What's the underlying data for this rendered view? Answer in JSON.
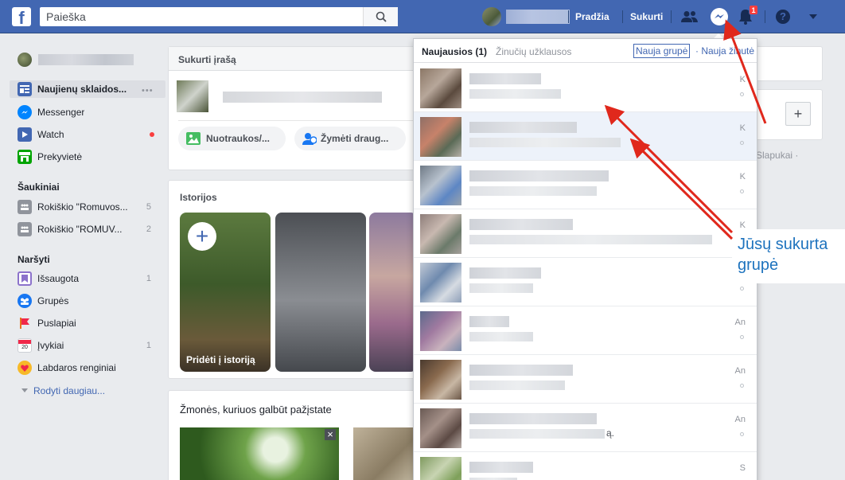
{
  "topbar": {
    "logo": "f",
    "search_placeholder": "Paieška",
    "nav_home": "Pradžia",
    "nav_create": "Sukurti",
    "notification_count": "1",
    "help_icon": "?"
  },
  "sidebar": {
    "feed": {
      "label": "Naujienų sklaidos...",
      "more": "•••"
    },
    "messenger": {
      "label": "Messenger"
    },
    "watch": {
      "label": "Watch"
    },
    "marketplace": {
      "label": "Prekyvietė"
    },
    "shortcuts_header": "Šaukiniai",
    "shortcuts": [
      {
        "label": "Rokiškio \"Romuvos...",
        "count": "5"
      },
      {
        "label": "Rokiškio \"ROMUV...",
        "count": "2"
      }
    ],
    "explore_header": "Naršyti",
    "explore": [
      {
        "label": "Išsaugota",
        "count": "1"
      },
      {
        "label": "Grupės",
        "count": ""
      },
      {
        "label": "Puslapiai",
        "count": ""
      },
      {
        "label": "Įvykiai",
        "count": "1"
      },
      {
        "label": "Labdaros renginiai",
        "count": ""
      }
    ],
    "show_more": "Rodyti daugiau..."
  },
  "composer": {
    "title": "Sukurti įrašą",
    "photo_button": "Nuotraukos/...",
    "tag_button": "Žymėti draug..."
  },
  "stories": {
    "title": "Istorijos",
    "add_label": "Pridėti į istoriją",
    "add_icon": "+"
  },
  "people": {
    "title": "Žmonės, kuriuos galbūt pažįstate",
    "close_icon": "×"
  },
  "right_rail": {
    "plus": "+",
    "cookies_text": "Slapukai ·"
  },
  "messenger_dropdown": {
    "tab_recent": "Naujausios (1)",
    "tab_requests": "Žinučių užklausos",
    "new_group": "Nauja grupė",
    "separator": "·",
    "new_message": "Nauja žinutė",
    "rows": [
      {
        "time": "K",
        "line2_suffix": ""
      },
      {
        "time": "K",
        "line2_suffix": ""
      },
      {
        "time": "K",
        "line2_suffix": ""
      },
      {
        "time": "K",
        "line2_suffix": ""
      },
      {
        "time": "",
        "line2_suffix": ""
      },
      {
        "time": "An",
        "line2_suffix": ""
      },
      {
        "time": "An",
        "line2_suffix": ""
      },
      {
        "time": "An",
        "line2_suffix": "ą."
      },
      {
        "time": "S",
        "line2_suffix": ""
      }
    ]
  },
  "annotation": {
    "line1": "Jūsų sukurta",
    "line2": "grupė"
  },
  "colors": {
    "brand_blue": "#4267b2",
    "annotation_red": "#e0281c",
    "annotation_text": "#1e73be"
  }
}
